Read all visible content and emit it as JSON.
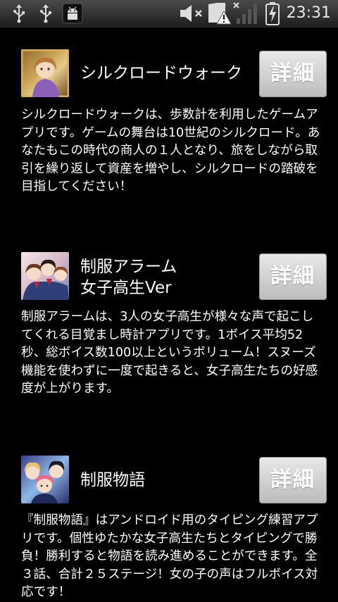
{
  "status_bar": {
    "time": "23:31",
    "icons": [
      "usb-icon",
      "usb-icon",
      "android-debug-icon",
      "volume-muted-icon",
      "sd-card-warning-icon",
      "signal-icon",
      "battery-charging-icon"
    ]
  },
  "apps": [
    {
      "title": "シルクロードウォーク",
      "detail_label": "詳細",
      "description": "シルクロードウォークは、歩数計を利用したゲームアプリです。ゲームの舞台は10世紀のシルクロード。あなたもこの時代の商人の１人となり、旅をしながら取引を繰り返して資産を増やし、シルクロードの踏破を目指してください！"
    },
    {
      "title": "制服アラーム\n女子高生Ver",
      "detail_label": "詳細",
      "description": "制服アラームは、3人の女子高生が様々な声で起こしてくれる目覚まし時計アプリです。1ボイス平均52秒、総ボイス数100以上というボリューム！スヌーズ機能を使わずに一度で起きると、女子高生たちの好感度が上がります。"
    },
    {
      "title": "制服物語",
      "detail_label": "詳細",
      "description": "『制服物語』はアンドロイド用のタイピング練習アプリです。個性ゆたかな女子高生たちとタイピングで勝負！勝利すると物語を読み進めることができます。全３話、合計２５ステージ！女の子の声はフルボイス対応です！"
    }
  ]
}
